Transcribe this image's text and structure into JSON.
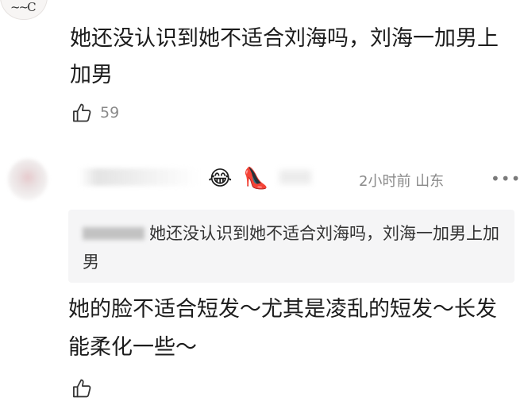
{
  "comment_1": {
    "text": "她还没认识到她不适合刘海吗，刘海一加男上加男",
    "like_count": "59"
  },
  "comment_2": {
    "time_location": "2小时前 山东",
    "emoji_1": "😂",
    "emoji_2": "👠",
    "quoted_text": "她还没认识到她不适合刘海吗，刘海一加男上加男",
    "text": "她的脸不适合短发～尤其是凌乱的短发～长发能柔化一些～"
  },
  "icons": {
    "like": "thumbs-up-icon",
    "more": "more-dots-icon"
  }
}
